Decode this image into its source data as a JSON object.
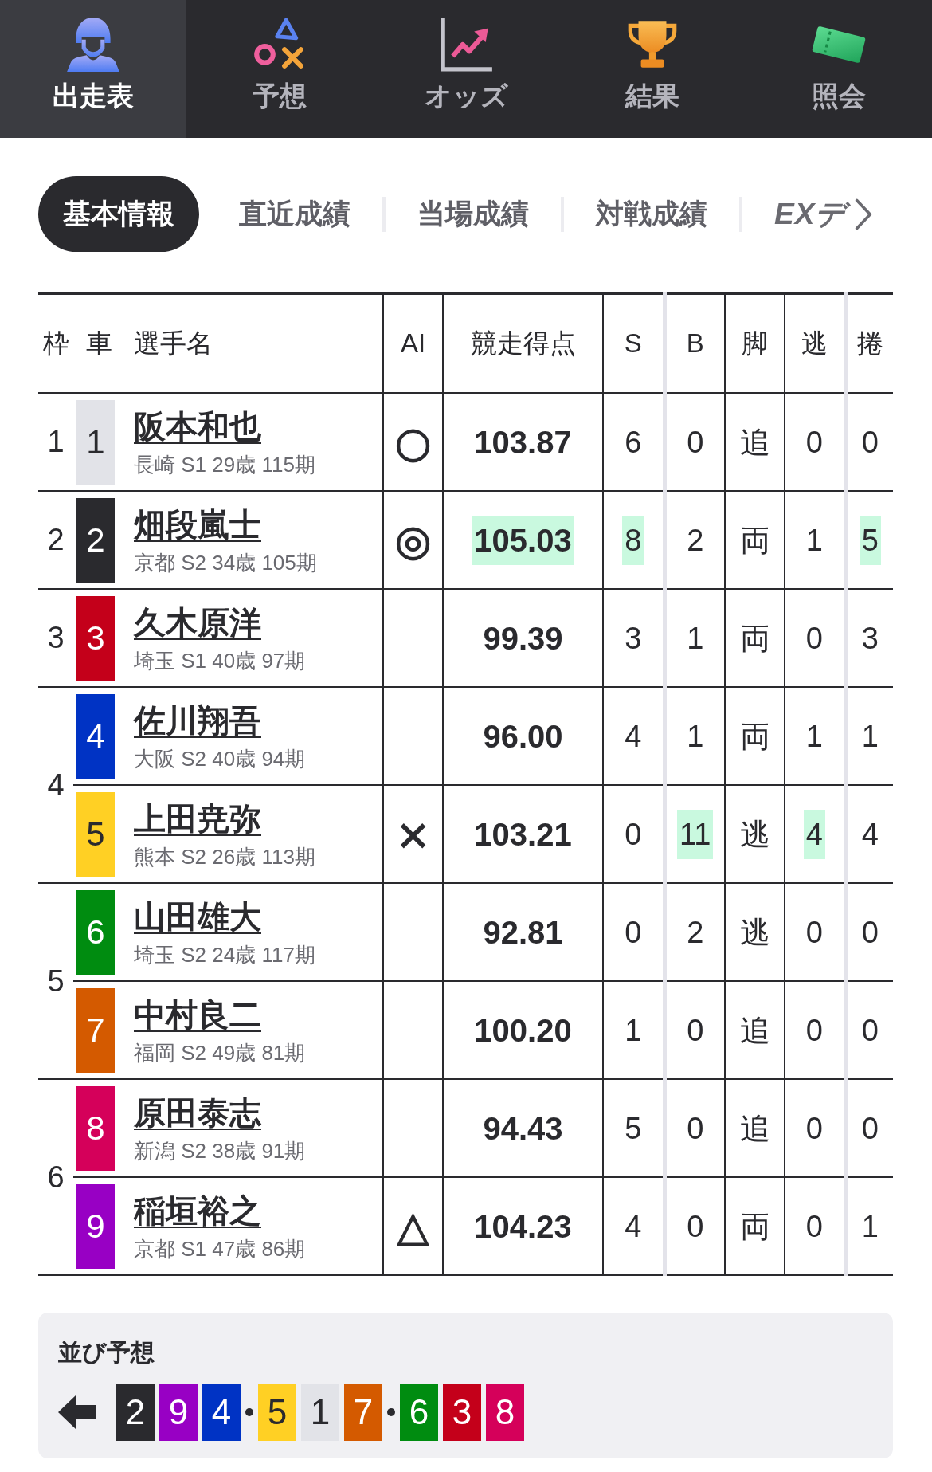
{
  "nav": {
    "items": [
      {
        "label": "出走表",
        "selected": true
      },
      {
        "label": "予想",
        "selected": false
      },
      {
        "label": "オッズ",
        "selected": false
      },
      {
        "label": "結果",
        "selected": false
      },
      {
        "label": "照会",
        "selected": false
      }
    ]
  },
  "tabs": [
    {
      "label": "基本情報",
      "kind": "label",
      "selected": true
    },
    {
      "label": "直近成績",
      "kind": "label",
      "selected": false
    },
    {
      "label": "当場成績",
      "kind": "label",
      "selected": false
    },
    {
      "label": "対戦成績",
      "kind": "label",
      "selected": false
    },
    {
      "label": "EXデ",
      "kind": "ex",
      "selected": false
    }
  ],
  "table": {
    "columns": [
      "枠",
      "車",
      "選手名",
      "AI",
      "競走得点",
      "S",
      "B",
      "脚",
      "逃",
      "捲"
    ],
    "frames": [
      {
        "number": "1",
        "cars": [
          {
            "car": "1",
            "color": "#e2e3e8",
            "name": "阪本和也",
            "info": "長崎 S1 29歳 115期",
            "ai": "○",
            "score": {
              "value": "103.87",
              "highlighted": false
            },
            "stats": [
              {
                "value": "6",
                "highlighted": false
              },
              {
                "value": "0",
                "highlighted": false
              },
              {
                "value": "追",
                "highlighted": false
              },
              {
                "value": "0",
                "highlighted": false
              },
              {
                "value": "0",
                "highlighted": false
              }
            ]
          }
        ]
      },
      {
        "number": "2",
        "cars": [
          {
            "car": "2",
            "color": "#2a2a2e",
            "name": "畑段嵐士",
            "info": "京都 S2 34歳 105期",
            "ai": "◎",
            "score": {
              "value": "105.03",
              "highlighted": true
            },
            "stats": [
              {
                "value": "8",
                "highlighted": true
              },
              {
                "value": "2",
                "highlighted": false
              },
              {
                "value": "両",
                "highlighted": false
              },
              {
                "value": "1",
                "highlighted": false
              },
              {
                "value": "5",
                "highlighted": true
              }
            ]
          }
        ]
      },
      {
        "number": "3",
        "cars": [
          {
            "car": "3",
            "color": "#c4001a",
            "name": "久木原洋",
            "info": "埼玉 S1 40歳 97期",
            "score": {
              "value": "99.39",
              "highlighted": false
            },
            "stats": [
              {
                "value": "3",
                "highlighted": false
              },
              {
                "value": "1",
                "highlighted": false
              },
              {
                "value": "両",
                "highlighted": false
              },
              {
                "value": "0",
                "highlighted": false
              },
              {
                "value": "3",
                "highlighted": false
              }
            ]
          }
        ]
      },
      {
        "number": "4",
        "cars": [
          {
            "car": "4",
            "color": "#0033c4",
            "name": "佐川翔吾",
            "info": "大阪 S2 40歳 94期",
            "score": {
              "value": "96.00",
              "highlighted": false
            },
            "stats": [
              {
                "value": "4",
                "highlighted": false
              },
              {
                "value": "1",
                "highlighted": false
              },
              {
                "value": "両",
                "highlighted": false
              },
              {
                "value": "1",
                "highlighted": false
              },
              {
                "value": "1",
                "highlighted": false
              }
            ]
          },
          {
            "car": "5",
            "color": "#ffd024",
            "name": "上田尭弥",
            "info": "熊本 S2 26歳 113期",
            "ai": "×",
            "score": {
              "value": "103.21",
              "highlighted": false
            },
            "stats": [
              {
                "value": "0",
                "highlighted": false
              },
              {
                "value": "11",
                "highlighted": true
              },
              {
                "value": "逃",
                "highlighted": false
              },
              {
                "value": "4",
                "highlighted": true
              },
              {
                "value": "4",
                "highlighted": false
              }
            ]
          }
        ]
      },
      {
        "number": "5",
        "cars": [
          {
            "car": "6",
            "color": "#008c10",
            "name": "山田雄大",
            "info": "埼玉 S2 24歳 117期",
            "score": {
              "value": "92.81",
              "highlighted": false
            },
            "stats": [
              {
                "value": "0",
                "highlighted": false
              },
              {
                "value": "2",
                "highlighted": false
              },
              {
                "value": "逃",
                "highlighted": false
              },
              {
                "value": "0",
                "highlighted": false
              },
              {
                "value": "0",
                "highlighted": false
              }
            ]
          },
          {
            "car": "7",
            "color": "#d45a00",
            "name": "中村良二",
            "info": "福岡 S2 49歳 81期",
            "score": {
              "value": "100.20",
              "highlighted": false
            },
            "stats": [
              {
                "value": "1",
                "highlighted": false
              },
              {
                "value": "0",
                "highlighted": false
              },
              {
                "value": "追",
                "highlighted": false
              },
              {
                "value": "0",
                "highlighted": false
              },
              {
                "value": "0",
                "highlighted": false
              }
            ]
          }
        ]
      },
      {
        "number": "6",
        "cars": [
          {
            "car": "8",
            "color": "#d5005a",
            "name": "原田泰志",
            "info": "新潟 S2 38歳 91期",
            "score": {
              "value": "94.43",
              "highlighted": false
            },
            "stats": [
              {
                "value": "5",
                "highlighted": false
              },
              {
                "value": "0",
                "highlighted": false
              },
              {
                "value": "追",
                "highlighted": false
              },
              {
                "value": "0",
                "highlighted": false
              },
              {
                "value": "0",
                "highlighted": false
              }
            ]
          },
          {
            "car": "9",
            "color": "#9800c4",
            "name": "稲垣裕之",
            "info": "京都 S1 47歳 86期",
            "ai": "△",
            "score": {
              "value": "104.23",
              "highlighted": false
            },
            "stats": [
              {
                "value": "4",
                "highlighted": false
              },
              {
                "value": "0",
                "highlighted": false
              },
              {
                "value": "両",
                "highlighted": false
              },
              {
                "value": "0",
                "highlighted": false
              },
              {
                "value": "1",
                "highlighted": false
              }
            ]
          }
        ]
      }
    ]
  },
  "line_forecast": {
    "title": "並び予想",
    "groups": [
      {
        "cars": [
          {
            "number": "2",
            "color": "#2a2a2e"
          },
          {
            "number": "9",
            "color": "#9800c4"
          },
          {
            "number": "4",
            "color": "#0033c4"
          }
        ]
      },
      {
        "cars": [
          {
            "number": "5",
            "color": "#ffd024"
          },
          {
            "number": "1",
            "color": "#e2e3e8"
          },
          {
            "number": "7",
            "color": "#d45a00"
          }
        ]
      },
      {
        "cars": [
          {
            "number": "6",
            "color": "#008c10"
          },
          {
            "number": "3",
            "color": "#c4001a"
          },
          {
            "number": "8",
            "color": "#d5005a"
          }
        ]
      }
    ]
  }
}
